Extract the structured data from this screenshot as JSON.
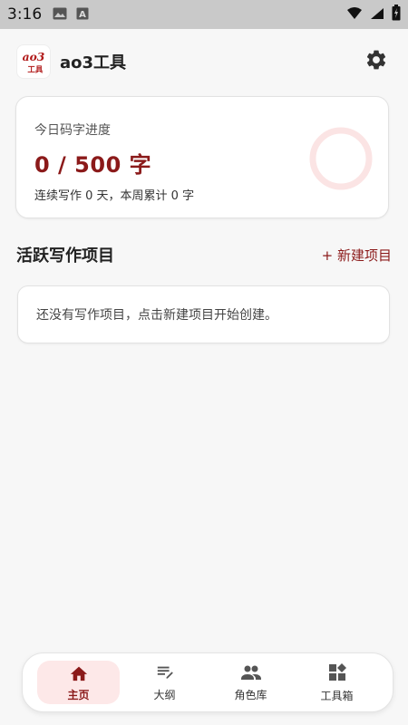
{
  "status_bar": {
    "time": "3:16",
    "left_icons": [
      "image-icon",
      "font-a-icon"
    ],
    "right_icons": [
      "wifi-icon",
      "signal-icon",
      "battery-icon"
    ]
  },
  "header": {
    "logo_text": "ao3",
    "logo_subtext": "工具",
    "title": "ao3工具",
    "settings_icon": "gear-icon"
  },
  "progress": {
    "label": "今日码字进度",
    "value": "0 / 500 字",
    "current": 0,
    "target": 500,
    "summary": "连续写作 0 天，本周累计 0 字"
  },
  "projects": {
    "title": "活跃写作项目",
    "new_label": "+ 新建项目",
    "empty_text": "还没有写作项目，点击新建项目开始创建。"
  },
  "nav": {
    "items": [
      {
        "label": "主页",
        "icon": "home-icon",
        "active": true
      },
      {
        "label": "大纲",
        "icon": "outline-icon",
        "active": false
      },
      {
        "label": "角色库",
        "icon": "people-icon",
        "active": false
      },
      {
        "label": "工具箱",
        "icon": "toolbox-icon",
        "active": false
      }
    ]
  },
  "colors": {
    "accent": "#8b1a1a",
    "active_bg": "#fde8e8",
    "ring": "#fbe4e4"
  }
}
